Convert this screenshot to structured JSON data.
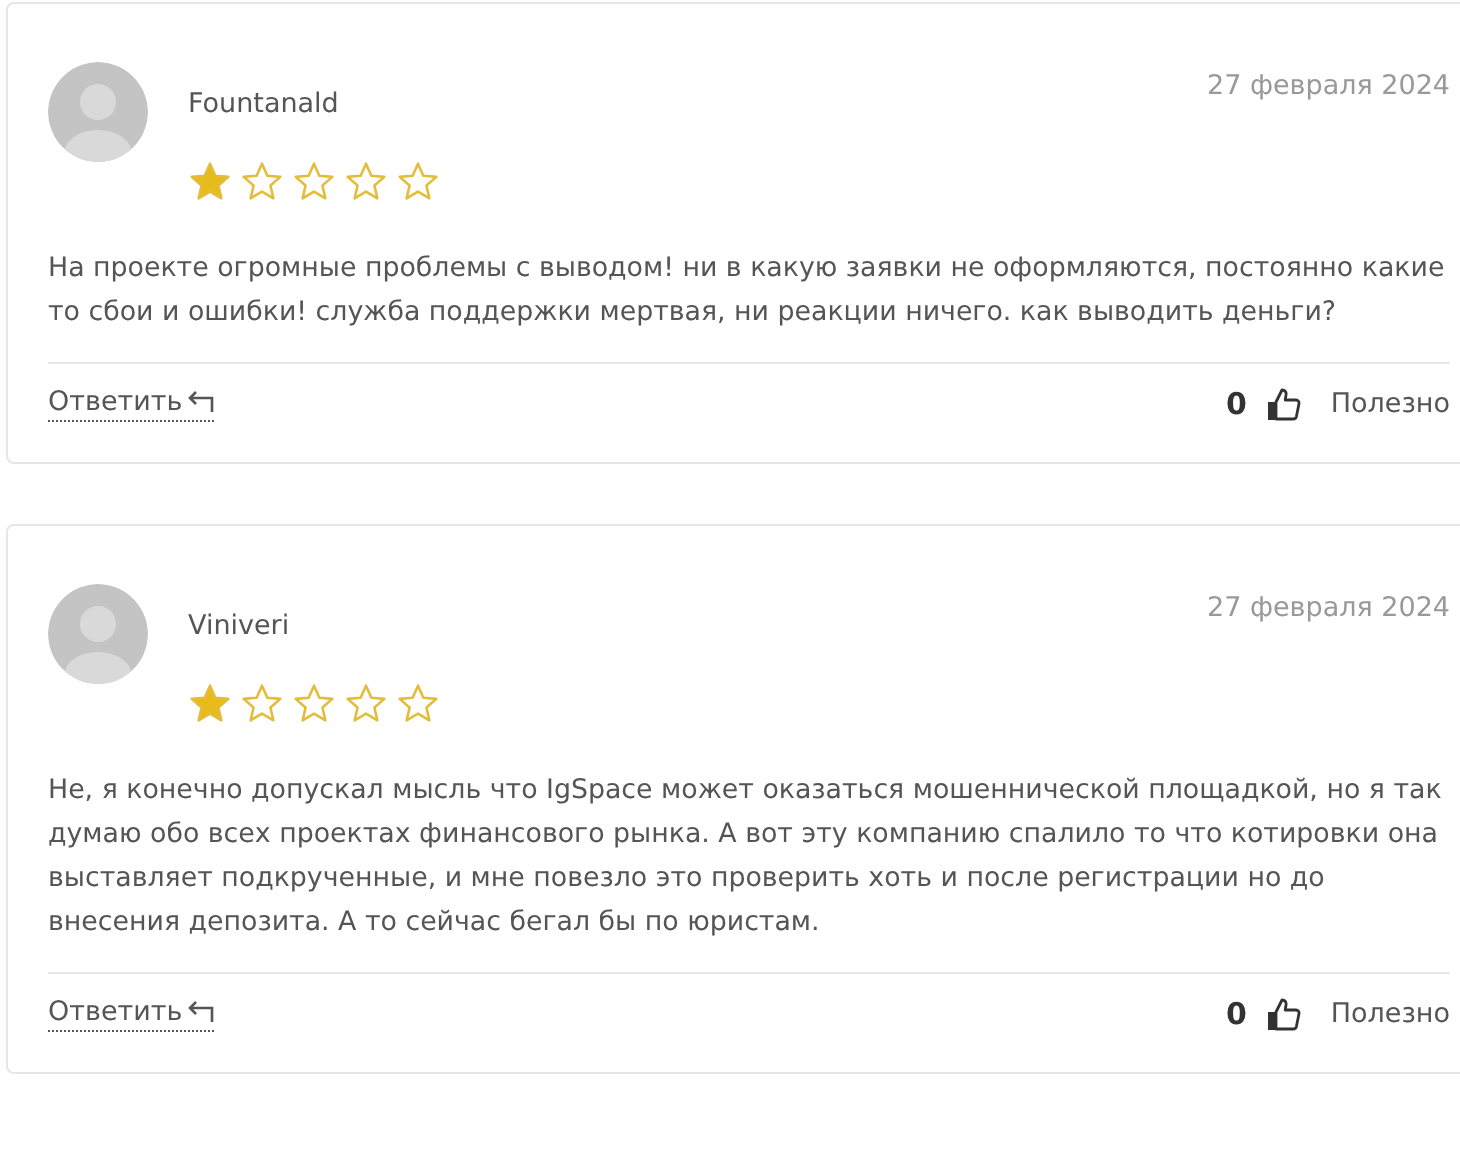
{
  "reviews": [
    {
      "author": "Fountanald",
      "date": "27 февраля 2024",
      "stars": 1,
      "text": "На проекте огромные проблемы с выводом! ни в какую заявки не оформляются, постоянно какие то сбои и ошибки! служба поддержки мертвая, ни реакции ничего. как выводить деньги?",
      "reply": "Ответить",
      "likes": "0",
      "helpful": "Полезно"
    },
    {
      "author": "Viniveri",
      "date": "27 февраля 2024",
      "stars": 1,
      "text": "Не, я конечно допускал мысль что IgSpace может оказаться мошеннической площадкой, но я так думаю обо всех проектах финансового рынка. А вот эту компанию спалило то что котировки она выставляет подкрученные, и мне повезло это проверить хоть и после регистрации но до внесения депозита. А то сейчас бегал бы по юристам.",
      "reply": "Ответить",
      "likes": "0",
      "helpful": "Полезно"
    }
  ]
}
